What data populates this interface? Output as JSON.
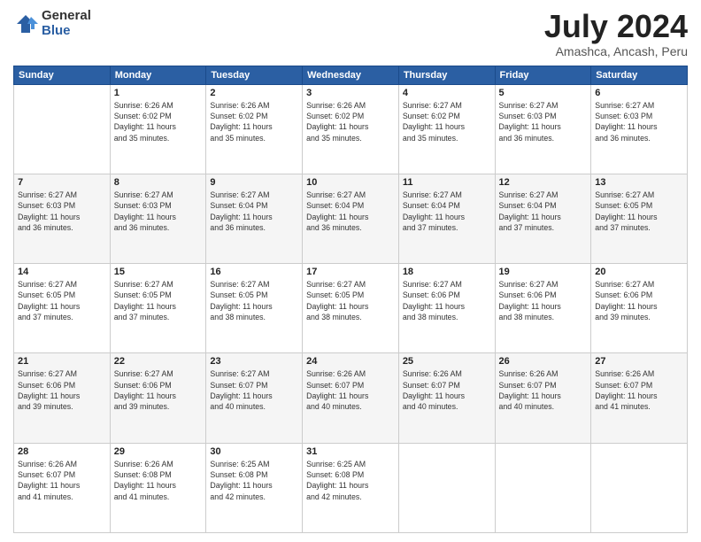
{
  "logo": {
    "general": "General",
    "blue": "Blue"
  },
  "header": {
    "month": "July 2024",
    "location": "Amashca, Ancash, Peru"
  },
  "weekdays": [
    "Sunday",
    "Monday",
    "Tuesday",
    "Wednesday",
    "Thursday",
    "Friday",
    "Saturday"
  ],
  "weeks": [
    [
      {
        "day": "",
        "info": ""
      },
      {
        "day": "1",
        "info": "Sunrise: 6:26 AM\nSunset: 6:02 PM\nDaylight: 11 hours\nand 35 minutes."
      },
      {
        "day": "2",
        "info": "Sunrise: 6:26 AM\nSunset: 6:02 PM\nDaylight: 11 hours\nand 35 minutes."
      },
      {
        "day": "3",
        "info": "Sunrise: 6:26 AM\nSunset: 6:02 PM\nDaylight: 11 hours\nand 35 minutes."
      },
      {
        "day": "4",
        "info": "Sunrise: 6:27 AM\nSunset: 6:02 PM\nDaylight: 11 hours\nand 35 minutes."
      },
      {
        "day": "5",
        "info": "Sunrise: 6:27 AM\nSunset: 6:03 PM\nDaylight: 11 hours\nand 36 minutes."
      },
      {
        "day": "6",
        "info": "Sunrise: 6:27 AM\nSunset: 6:03 PM\nDaylight: 11 hours\nand 36 minutes."
      }
    ],
    [
      {
        "day": "7",
        "info": "Sunrise: 6:27 AM\nSunset: 6:03 PM\nDaylight: 11 hours\nand 36 minutes."
      },
      {
        "day": "8",
        "info": "Sunrise: 6:27 AM\nSunset: 6:03 PM\nDaylight: 11 hours\nand 36 minutes."
      },
      {
        "day": "9",
        "info": "Sunrise: 6:27 AM\nSunset: 6:04 PM\nDaylight: 11 hours\nand 36 minutes."
      },
      {
        "day": "10",
        "info": "Sunrise: 6:27 AM\nSunset: 6:04 PM\nDaylight: 11 hours\nand 36 minutes."
      },
      {
        "day": "11",
        "info": "Sunrise: 6:27 AM\nSunset: 6:04 PM\nDaylight: 11 hours\nand 37 minutes."
      },
      {
        "day": "12",
        "info": "Sunrise: 6:27 AM\nSunset: 6:04 PM\nDaylight: 11 hours\nand 37 minutes."
      },
      {
        "day": "13",
        "info": "Sunrise: 6:27 AM\nSunset: 6:05 PM\nDaylight: 11 hours\nand 37 minutes."
      }
    ],
    [
      {
        "day": "14",
        "info": "Sunrise: 6:27 AM\nSunset: 6:05 PM\nDaylight: 11 hours\nand 37 minutes."
      },
      {
        "day": "15",
        "info": "Sunrise: 6:27 AM\nSunset: 6:05 PM\nDaylight: 11 hours\nand 37 minutes."
      },
      {
        "day": "16",
        "info": "Sunrise: 6:27 AM\nSunset: 6:05 PM\nDaylight: 11 hours\nand 38 minutes."
      },
      {
        "day": "17",
        "info": "Sunrise: 6:27 AM\nSunset: 6:05 PM\nDaylight: 11 hours\nand 38 minutes."
      },
      {
        "day": "18",
        "info": "Sunrise: 6:27 AM\nSunset: 6:06 PM\nDaylight: 11 hours\nand 38 minutes."
      },
      {
        "day": "19",
        "info": "Sunrise: 6:27 AM\nSunset: 6:06 PM\nDaylight: 11 hours\nand 38 minutes."
      },
      {
        "day": "20",
        "info": "Sunrise: 6:27 AM\nSunset: 6:06 PM\nDaylight: 11 hours\nand 39 minutes."
      }
    ],
    [
      {
        "day": "21",
        "info": "Sunrise: 6:27 AM\nSunset: 6:06 PM\nDaylight: 11 hours\nand 39 minutes."
      },
      {
        "day": "22",
        "info": "Sunrise: 6:27 AM\nSunset: 6:06 PM\nDaylight: 11 hours\nand 39 minutes."
      },
      {
        "day": "23",
        "info": "Sunrise: 6:27 AM\nSunset: 6:07 PM\nDaylight: 11 hours\nand 40 minutes."
      },
      {
        "day": "24",
        "info": "Sunrise: 6:26 AM\nSunset: 6:07 PM\nDaylight: 11 hours\nand 40 minutes."
      },
      {
        "day": "25",
        "info": "Sunrise: 6:26 AM\nSunset: 6:07 PM\nDaylight: 11 hours\nand 40 minutes."
      },
      {
        "day": "26",
        "info": "Sunrise: 6:26 AM\nSunset: 6:07 PM\nDaylight: 11 hours\nand 40 minutes."
      },
      {
        "day": "27",
        "info": "Sunrise: 6:26 AM\nSunset: 6:07 PM\nDaylight: 11 hours\nand 41 minutes."
      }
    ],
    [
      {
        "day": "28",
        "info": "Sunrise: 6:26 AM\nSunset: 6:07 PM\nDaylight: 11 hours\nand 41 minutes."
      },
      {
        "day": "29",
        "info": "Sunrise: 6:26 AM\nSunset: 6:08 PM\nDaylight: 11 hours\nand 41 minutes."
      },
      {
        "day": "30",
        "info": "Sunrise: 6:25 AM\nSunset: 6:08 PM\nDaylight: 11 hours\nand 42 minutes."
      },
      {
        "day": "31",
        "info": "Sunrise: 6:25 AM\nSunset: 6:08 PM\nDaylight: 11 hours\nand 42 minutes."
      },
      {
        "day": "",
        "info": ""
      },
      {
        "day": "",
        "info": ""
      },
      {
        "day": "",
        "info": ""
      }
    ]
  ]
}
